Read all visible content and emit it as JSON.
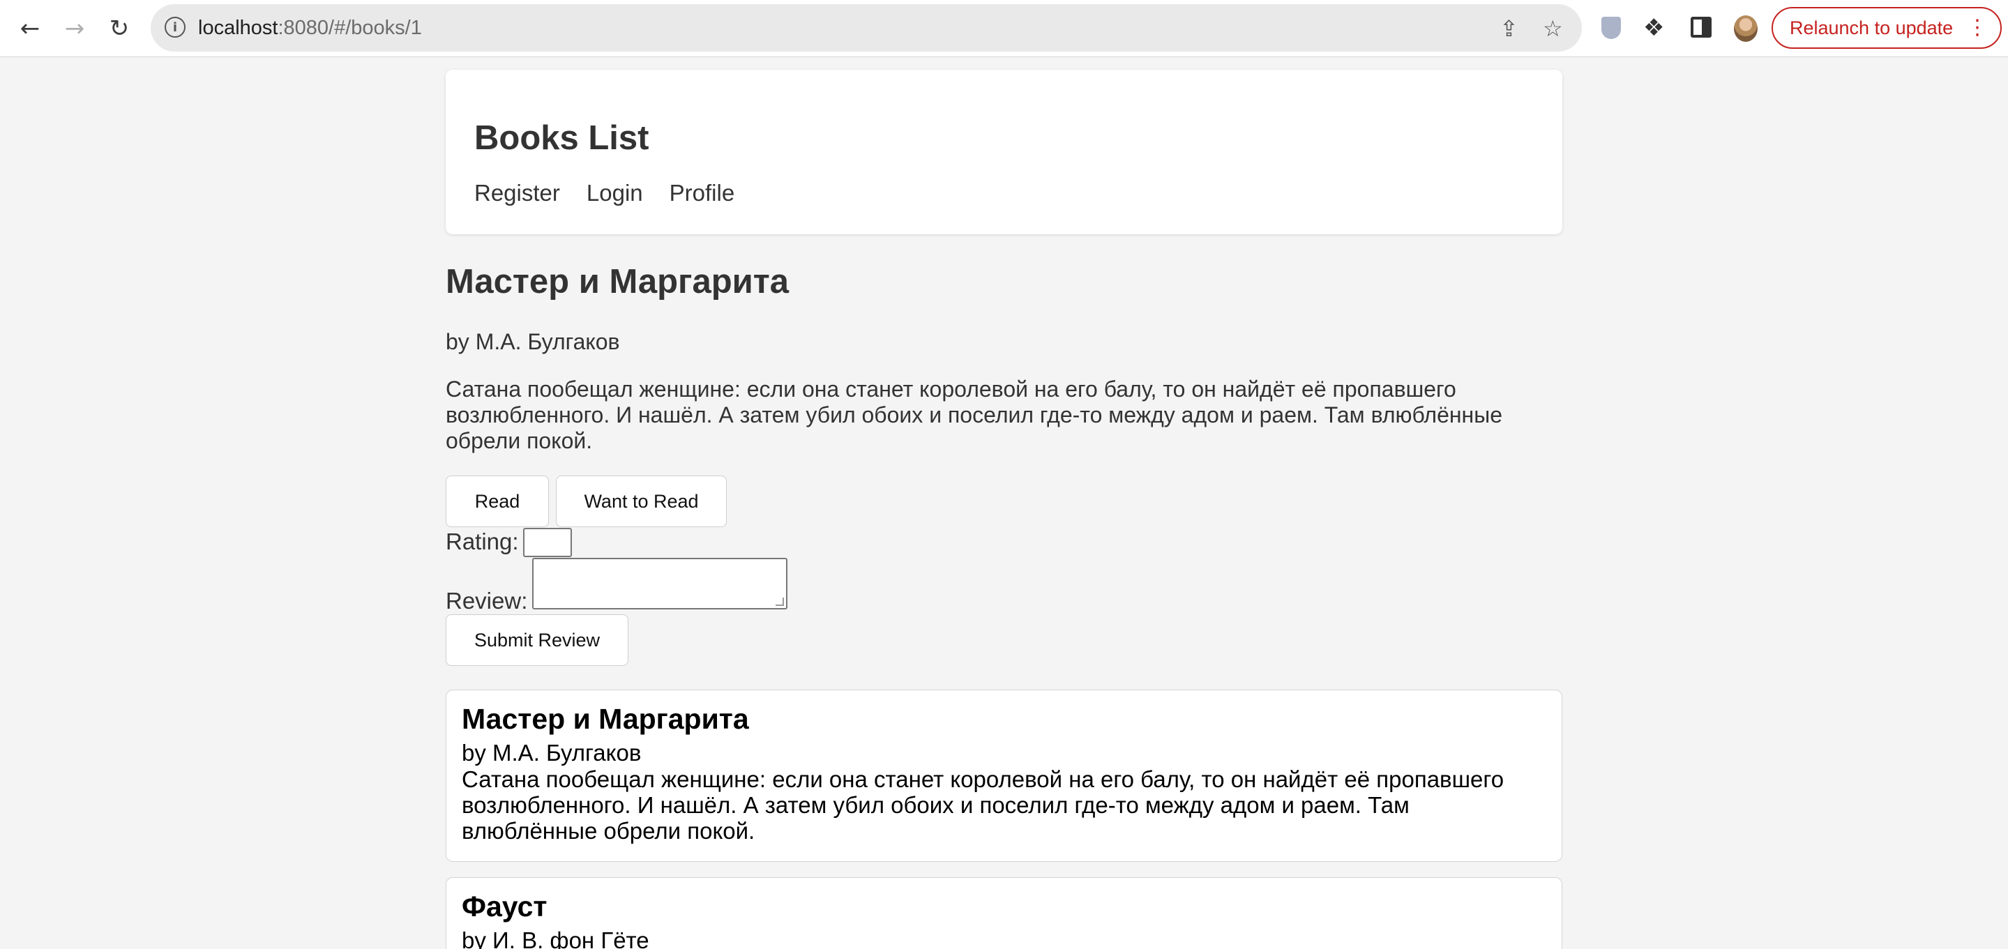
{
  "browser": {
    "url_host": "localhost",
    "url_rest": ":8080/#/books/1",
    "relaunch_label": "Relaunch to update"
  },
  "header": {
    "title": "Books List",
    "nav": [
      "Register",
      "Login",
      "Profile"
    ]
  },
  "book": {
    "title": "Мастер и Маргарита",
    "author": "by М.А. Булгаков",
    "description": "Сатана пообещал женщине: если она станет королевой на его балу, то он найдёт её пропавшего возлюбленного. И нашёл. А затем убил обоих и поселил где-то между адом и раем. Там влюблённые обрели покой."
  },
  "actions": {
    "read_label": "Read",
    "want_label": "Want to Read",
    "rating_label": "Rating:",
    "review_label": "Review:",
    "submit_label": "Submit Review"
  },
  "book_list": [
    {
      "title": "Мастер и Маргарита",
      "author": "by М.А. Булгаков",
      "description": "Сатана пообещал женщине: если она станет королевой на его балу, то он найдёт её пропавшего возлюбленного. И нашёл. А затем убил обоих и поселил где-то между адом и раем. Там влюблённые обрели покой."
    },
    {
      "title": "Фауст",
      "author": "by И. В. фон Гёте",
      "description": ""
    }
  ],
  "icons": {
    "back": "back-arrow-icon",
    "forward": "forward-arrow-icon",
    "reload": "reload-icon",
    "info": "site-info-icon",
    "share": "share-icon",
    "star": "bookmark-star-icon",
    "shield": "extension-shield-icon",
    "puzzle": "extensions-puzzle-icon",
    "panel": "side-panel-icon",
    "menu": "more-vert-icon"
  }
}
